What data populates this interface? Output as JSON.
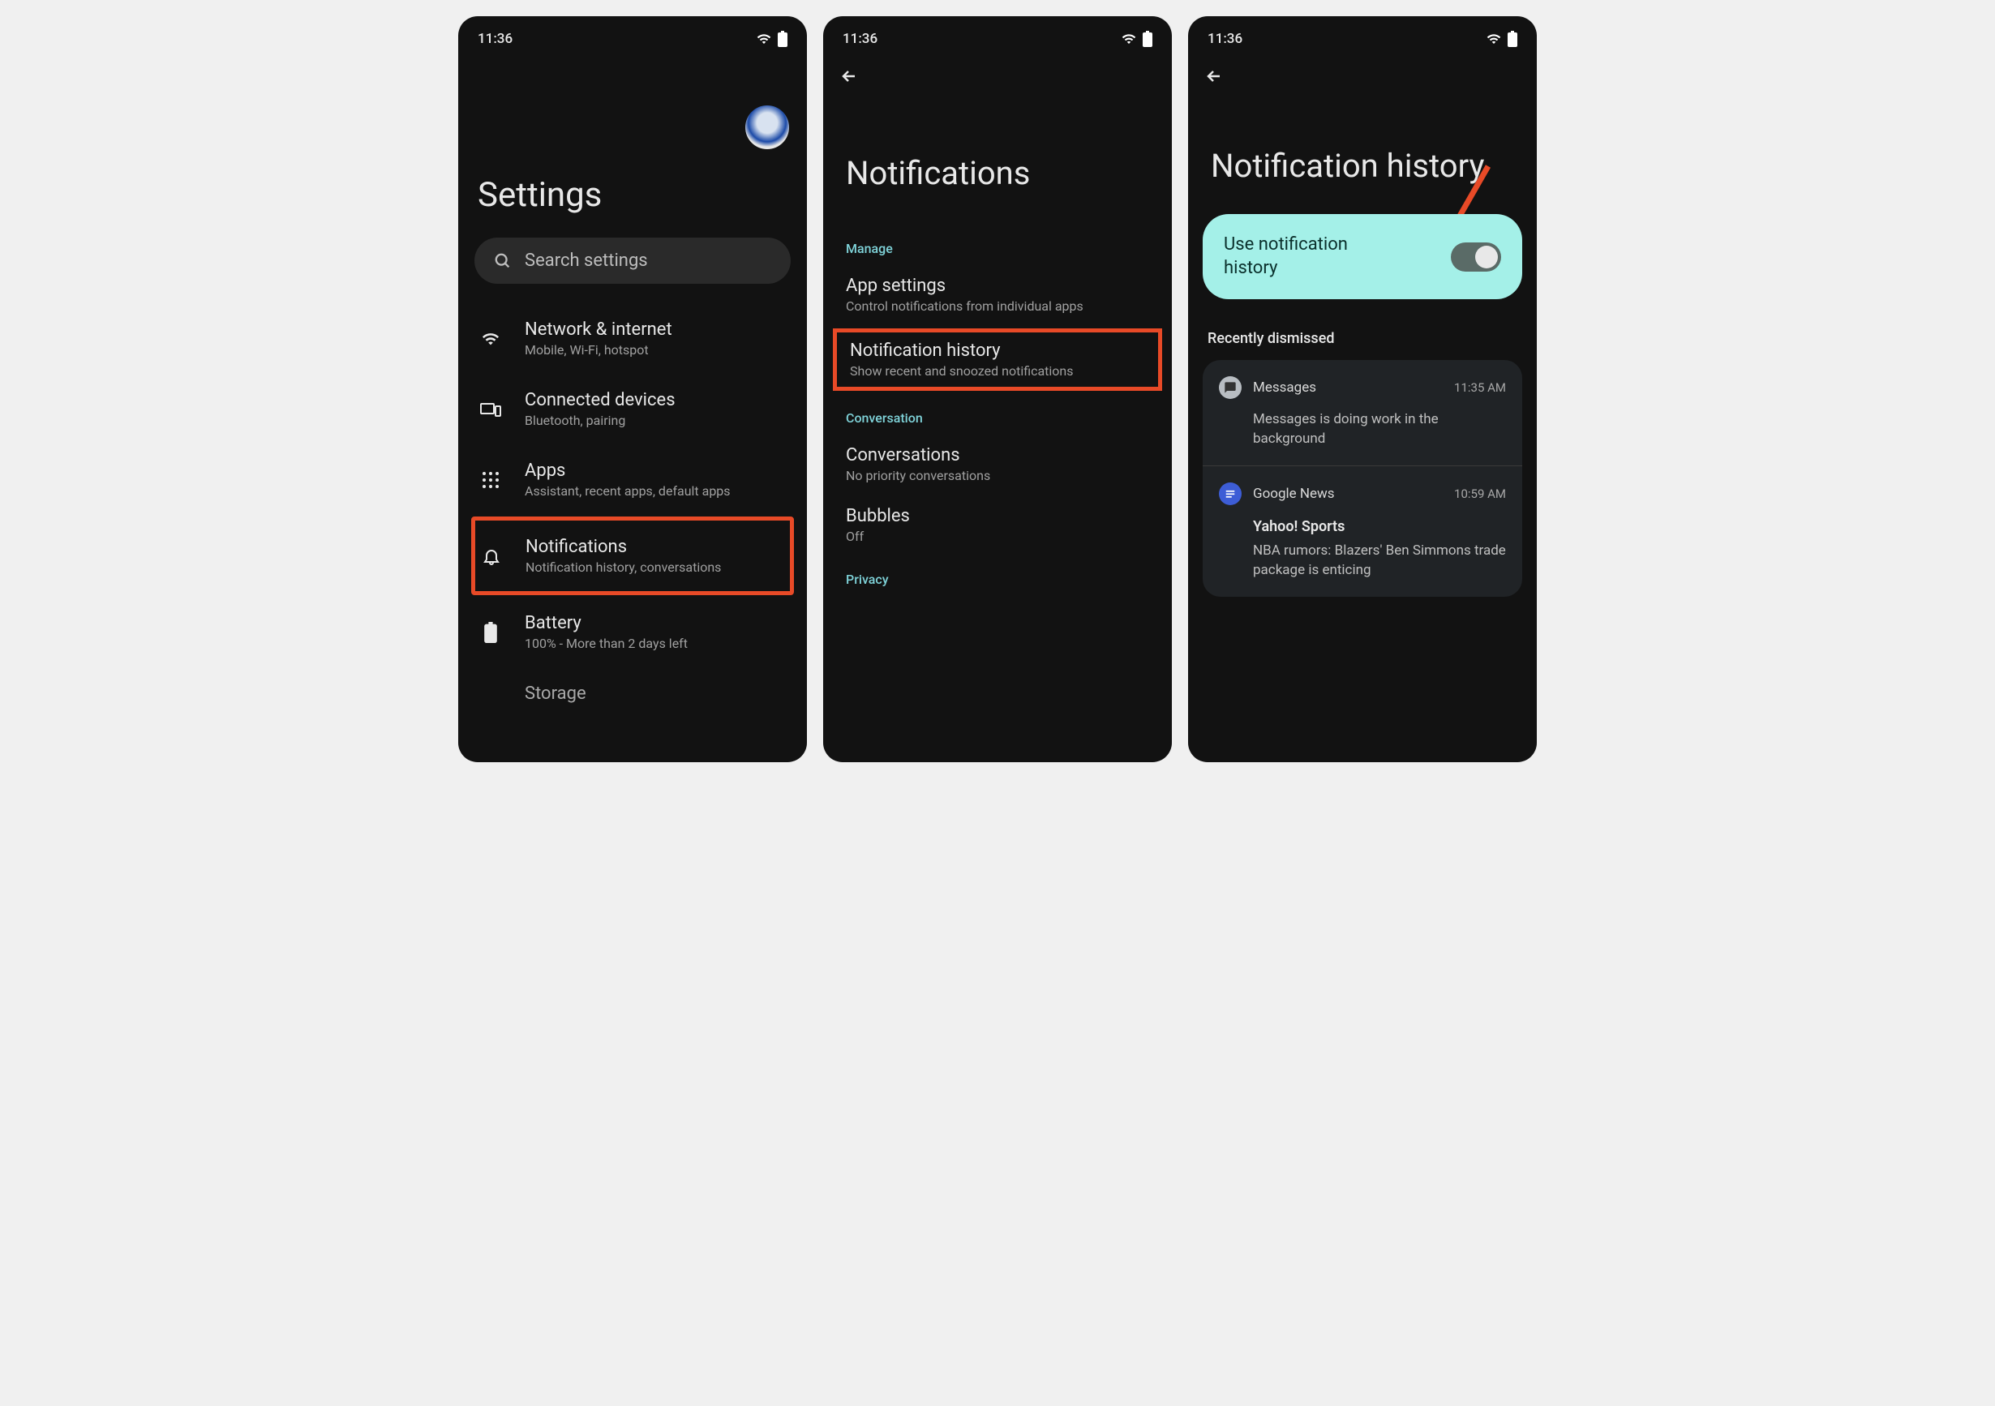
{
  "status": {
    "time": "11:36"
  },
  "screen1": {
    "title": "Settings",
    "search_placeholder": "Search settings",
    "items": [
      {
        "title": "Network & internet",
        "subtitle": "Mobile, Wi-Fi, hotspot"
      },
      {
        "title": "Connected devices",
        "subtitle": "Bluetooth, pairing"
      },
      {
        "title": "Apps",
        "subtitle": "Assistant, recent apps, default apps"
      },
      {
        "title": "Notifications",
        "subtitle": "Notification history, conversations"
      },
      {
        "title": "Battery",
        "subtitle": "100% - More than 2 days left"
      },
      {
        "title": "Storage",
        "subtitle": ""
      }
    ]
  },
  "screen2": {
    "title": "Notifications",
    "section_manage": "Manage",
    "section_conversation": "Conversation",
    "section_privacy": "Privacy",
    "items": [
      {
        "title": "App settings",
        "subtitle": "Control notifications from individual apps"
      },
      {
        "title": "Notification history",
        "subtitle": "Show recent and snoozed notifications"
      },
      {
        "title": "Conversations",
        "subtitle": "No priority conversations"
      },
      {
        "title": "Bubbles",
        "subtitle": "Off"
      }
    ]
  },
  "screen3": {
    "title": "Notification history",
    "toggle_label": "Use notification history",
    "section_recent": "Recently dismissed",
    "dismissed": [
      {
        "app": "Messages",
        "time": "11:35 AM",
        "title": "",
        "body": "Messages is doing work in the background"
      },
      {
        "app": "Google News",
        "time": "10:59 AM",
        "title": "Yahoo! Sports",
        "body": "NBA rumors: Blazers' Ben Simmons trade package is enticing"
      }
    ]
  }
}
